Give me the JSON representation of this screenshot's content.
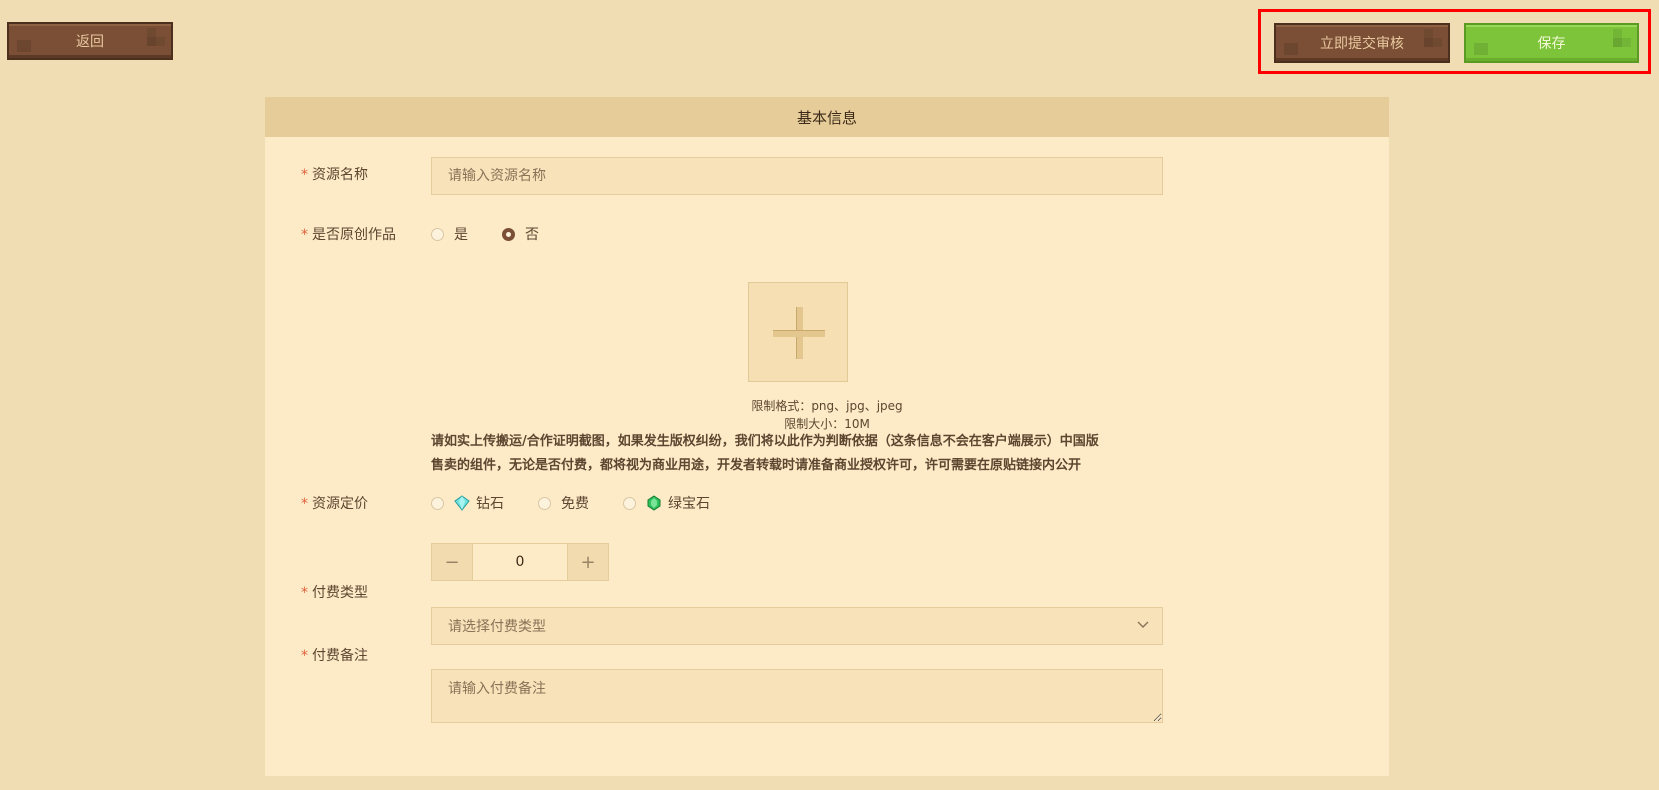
{
  "toolbar": {
    "back_label": "返回",
    "submit_label": "立即提交审核",
    "save_label": "保存"
  },
  "panel": {
    "title": "基本信息"
  },
  "form": {
    "name": {
      "label": "资源名称",
      "placeholder": "请输入资源名称"
    },
    "original": {
      "label": "是否原创作品",
      "options": [
        "是",
        "否"
      ],
      "selected": "否"
    },
    "upload": {
      "format_hint": "限制格式：png、jpg、jpeg",
      "size_hint": "限制大小：10M",
      "notice_line1": "请如实上传搬运/合作证明截图，如果发生版权纠纷，我们将以此作为判断依据（这条信息不会在客户端展示）中国版",
      "notice_line2": "售卖的组件，无论是否付费，都将视为商业用途，开发者转载时请准备商业授权许可，许可需要在原贴链接内公开"
    },
    "price": {
      "label": "资源定价",
      "options": [
        {
          "label": "钻石",
          "icon": "diamond-icon"
        },
        {
          "label": "免费",
          "icon": ""
        },
        {
          "label": "绿宝石",
          "icon": "emerald-icon"
        }
      ],
      "stepper_value": "0",
      "minus": "−",
      "plus": "+"
    },
    "pay_type": {
      "label": "付费类型",
      "placeholder": "请选择付费类型"
    },
    "pay_note": {
      "label": "付费备注",
      "placeholder": "请输入付费备注"
    }
  },
  "colors": {
    "background": "#f0ddb3",
    "panel": "#fdebc7",
    "brown_button": "#7a4f35",
    "green_button": "#7dc43a",
    "required_star": "#e0603c",
    "highlight": "#ff0000"
  }
}
